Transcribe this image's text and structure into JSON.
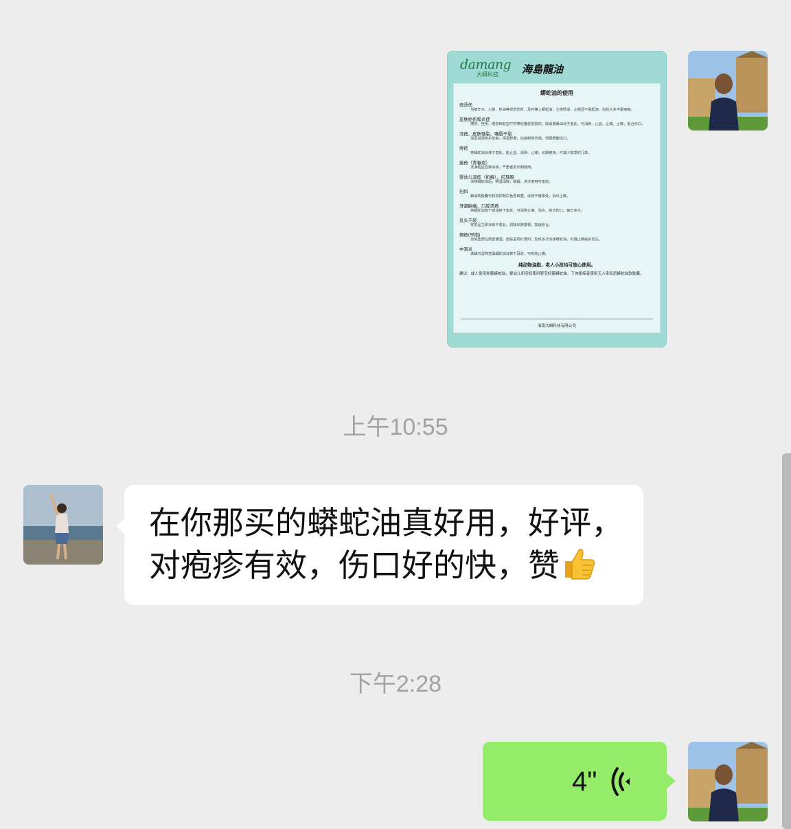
{
  "messages": [
    {
      "type": "image",
      "sender": "me",
      "card": {
        "brand_logo": "damang",
        "brand_sub": "大蟒科技",
        "brand_name": "海島龍油",
        "title": "蟒蛇油的使用",
        "sections": [
          {
            "heading": "烧烫伤",
            "body": "当被开水、火苗、热油等烧烫伤时，及时擦上蟒蛇油，立感舒适，止痛且不易起泡，愈后大多不留疤痕。"
          },
          {
            "heading": "皮肤损伤和炎症",
            "body": "擦伤、挫伤、晒伤和蚊虫叮咬等轻度皮肤损伤，取适量蟒油涂于患处，可消肿、止血、止痛、止痒，愈合伤口。"
          },
          {
            "heading": "冻疮、皮肤皲裂、嘴唇干裂",
            "body": "深层滋润修护皮肤，保湿舒缓，加速新陈代谢，增强细胞活力。"
          },
          {
            "heading": "痔疮",
            "body": "将蟒蛇油涂抹于患处，能止血、消肿、止痛；长期使用，可减少复发的几率。"
          },
          {
            "heading": "痤疮（青春痘）",
            "body": "洗净脸后直接涂抹，严重者需长期使用。"
          },
          {
            "heading": "婴幼儿湿疹（奶癣）、红屁股",
            "body": "涂抹蟒蛇油后，啊湿消除，缓解，多次使用可痊愈。"
          },
          {
            "heading": "妇科",
            "body": "蟒油软胶囊可有效抑制白色念珠菌，涂抹于瘙痒处，消炎止痒。"
          },
          {
            "heading": "牙龈肿痛、口腔溃疡",
            "body": "将蟒蛇油滴于或涂抹于患处，可消肿止痛、消炎、愈合伤口，每日多次。"
          },
          {
            "heading": "乳头干裂",
            "body": "将本品立即涂抹于患处，润除红肿皲裂，加速愈合。"
          },
          {
            "heading": "褥疮(早期)",
            "body": "当受压部位局部潮湿，皮肤呈现红斑时，及时多次涂抹蟒蛇油，可阻止褥疮的发生。"
          },
          {
            "heading": "中耳炎",
            "body": "滴蟒可湿棉签蘸蟒蛇油涂抹于耳道，可有效止痛。"
          }
        ],
        "note": "纯动物油脂，老人小孩均可放心使用。",
        "advice": "建议：成人使用抑菌蟒蛇油，婴幼儿和宝妈使用婴宝抑菌蟒蛇油，下体瘙痒者使用玉人来私密蟒蛇油软胶囊。",
        "footer": "海南大蟒科技有限公司"
      }
    },
    {
      "type": "time",
      "text": "上午10:55"
    },
    {
      "type": "text",
      "sender": "other",
      "lines": [
        "在你那买的蟒蛇油真好用，好评，",
        "对疱疹有效，伤口好的快，赞"
      ],
      "emoji": "thumbs-up"
    },
    {
      "type": "time",
      "text": "下午2:28"
    },
    {
      "type": "voice",
      "sender": "me",
      "duration": "4\""
    }
  ],
  "colors": {
    "background": "#ededed",
    "my_bubble": "#95ec69",
    "other_bubble": "#ffffff",
    "timestamp": "#a2a2a2",
    "card_frame": "#9fdad4"
  }
}
